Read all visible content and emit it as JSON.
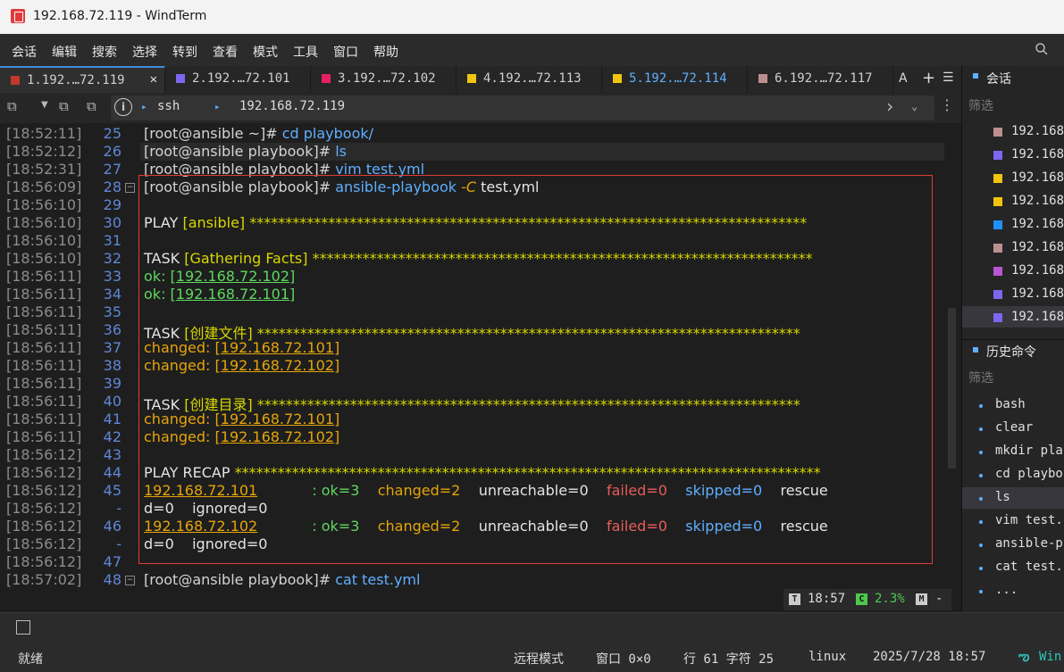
{
  "window": {
    "title": "192.168.72.119 - WindTerm"
  },
  "menu": [
    "会话",
    "编辑",
    "搜索",
    "选择",
    "转到",
    "查看",
    "模式",
    "工具",
    "窗口",
    "帮助"
  ],
  "tabs": [
    {
      "label": "1.192.…72.119",
      "color": "#c0392b",
      "active": true
    },
    {
      "label": "2.192.…72.101",
      "color": "#7b68ee",
      "active": false
    },
    {
      "label": "3.192.…72.102",
      "color": "#e91e63",
      "active": false
    },
    {
      "label": "4.192.…72.113",
      "color": "#f1c40f",
      "active": false
    },
    {
      "label": "5.192.…72.114",
      "color": "#f1c40f",
      "active": false
    },
    {
      "label": "6.192.…72.117",
      "color": "#bc8f8f",
      "active": false
    }
  ],
  "tab_more": "A",
  "address": {
    "protocol": "ssh",
    "host": "192.168.72.119"
  },
  "terminal": {
    "lines": [
      {
        "ts": "[18:52:11]",
        "ln": "25",
        "prompt": "[root@ansible ~]# ",
        "cmd": "cd playbook/"
      },
      {
        "ts": "[18:52:12]",
        "ln": "26",
        "prompt": "[root@ansible playbook]# ",
        "cmd": "ls"
      },
      {
        "ts": "[18:52:31]",
        "ln": "27",
        "prompt": "[root@ansible playbook]# ",
        "cmd": "vim test.yml"
      },
      {
        "ts": "[18:56:09]",
        "ln": "28",
        "prompt": "[root@ansible playbook]# ",
        "cmd": "ansible-playbook",
        "opt": "-C",
        "arg": "test.yml"
      },
      {
        "ts": "[18:56:10]",
        "ln": "29"
      },
      {
        "ts": "[18:56:10]",
        "ln": "30",
        "text": "PLAY [ansible] ******************************************************************************"
      },
      {
        "ts": "[18:56:10]",
        "ln": "31"
      },
      {
        "ts": "[18:56:10]",
        "ln": "32",
        "text": "TASK [Gathering Facts] **********************************************************************"
      },
      {
        "ts": "[18:56:11]",
        "ln": "33",
        "status": "ok",
        "host": "192.168.72.102"
      },
      {
        "ts": "[18:56:11]",
        "ln": "34",
        "status": "ok",
        "host": "192.168.72.101"
      },
      {
        "ts": "[18:56:11]",
        "ln": "35"
      },
      {
        "ts": "[18:56:11]",
        "ln": "36",
        "text": "TASK [创建文件] ****************************************************************************"
      },
      {
        "ts": "[18:56:11]",
        "ln": "37",
        "status": "changed",
        "host": "192.168.72.101"
      },
      {
        "ts": "[18:56:11]",
        "ln": "38",
        "status": "changed",
        "host": "192.168.72.102"
      },
      {
        "ts": "[18:56:11]",
        "ln": "39"
      },
      {
        "ts": "[18:56:11]",
        "ln": "40",
        "text": "TASK [创建目录] ****************************************************************************"
      },
      {
        "ts": "[18:56:11]",
        "ln": "41",
        "status": "changed",
        "host": "192.168.72.101"
      },
      {
        "ts": "[18:56:11]",
        "ln": "42",
        "status": "changed",
        "host": "192.168.72.102"
      },
      {
        "ts": "[18:56:12]",
        "ln": "43"
      },
      {
        "ts": "[18:56:12]",
        "ln": "44",
        "text": "PLAY RECAP **********************************************************************************"
      },
      {
        "ts": "[18:56:12]",
        "ln": "45",
        "recap": {
          "host": "192.168.72.101",
          "ok": ": ok=3",
          "changed": "changed=2",
          "unreachable": "unreachable=0",
          "failed": "failed=0",
          "skipped": "skipped=0",
          "rescue": "rescue"
        }
      },
      {
        "ts": "[18:56:12]",
        "ln": "-",
        "cont": "d=0    ignored=0"
      },
      {
        "ts": "[18:56:12]",
        "ln": "46",
        "recap": {
          "host": "192.168.72.102",
          "ok": ": ok=3",
          "changed": "changed=2",
          "unreachable": "unreachable=0",
          "failed": "failed=0",
          "skipped": "skipped=0",
          "rescue": "rescue"
        }
      },
      {
        "ts": "[18:56:12]",
        "ln": "-",
        "cont": "d=0    ignored=0"
      },
      {
        "ts": "[18:56:12]",
        "ln": "47"
      },
      {
        "ts": "[18:57:02]",
        "ln": "48",
        "prompt": "[root@ansible playbook]# ",
        "cmd": "cat test.yml"
      }
    ],
    "status": {
      "t_badge": "T",
      "time": "18:57",
      "c_badge": "C",
      "cpu": "2.3%",
      "m_badge": "M",
      "mem": "-"
    }
  },
  "right_panel": {
    "sessions_title": "会话",
    "filter": "筛选",
    "sessions": [
      {
        "label": "192.168",
        "color": "#bc8f8f"
      },
      {
        "label": "192.168",
        "color": "#7b68ee"
      },
      {
        "label": "192.168",
        "color": "#f1c40f"
      },
      {
        "label": "192.168",
        "color": "#f1c40f"
      },
      {
        "label": "192.168",
        "color": "#1e90ff"
      },
      {
        "label": "192.168",
        "color": "#bc8f8f"
      },
      {
        "label": "192.168",
        "color": "#ba55d3"
      },
      {
        "label": "192.168",
        "color": "#7b68ee"
      },
      {
        "label": "192.168",
        "color": "#7b68ee"
      }
    ],
    "history_title": "历史命令",
    "history_filter": "筛选",
    "history": [
      "bash",
      "clear",
      "mkdir pla",
      "cd playbo",
      "ls",
      "vim test.",
      "ansible-p",
      "cat test.",
      "..."
    ]
  },
  "statusbar": {
    "ready": "就绪",
    "mode": "远程模式",
    "window": "窗口 0×0",
    "position": "行 61 字符 25",
    "os": "linux",
    "datetime": "2025/7/28 18:57",
    "brand": "Win"
  }
}
